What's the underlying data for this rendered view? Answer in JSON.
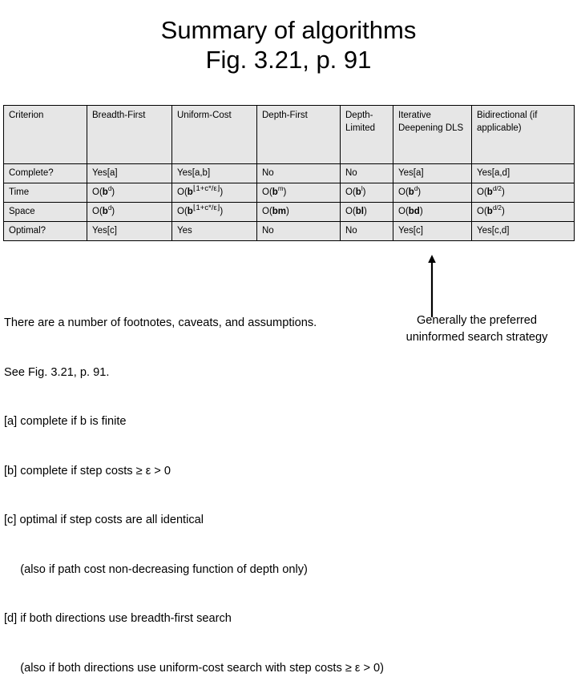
{
  "title": {
    "line1": "Summary of algorithms",
    "line2": "Fig. 3.21, p. 91"
  },
  "table": {
    "headers": [
      "Criterion",
      "Breadth-First",
      "Uniform-Cost",
      "Depth-First",
      "Depth-Limited",
      "Iterative Deepening DLS",
      "Bidirectional (if applicable)"
    ],
    "rows": [
      {
        "criterion": "Complete?",
        "bfs": "Yes[a]",
        "ucs": "Yes[a,b]",
        "dfs": "No",
        "dls": "No",
        "ids": "Yes[a]",
        "bidir": "Yes[a,d]"
      },
      {
        "criterion": "Time",
        "bfs": "O(b^d)",
        "ucs": "O(b^⌊1+C*/ε⌋)",
        "dfs": "O(b^m)",
        "dls": "O(b^l)",
        "ids": "O(b^d)",
        "bidir": "O(b^d/2)"
      },
      {
        "criterion": "Space",
        "bfs": "O(b^d)",
        "ucs": "O(b^⌊1+C*/ε⌋)",
        "dfs": "O(bm)",
        "dls": "O(bl)",
        "ids": "O(bd)",
        "bidir": "O(b^d/2)"
      },
      {
        "criterion": "Optimal?",
        "bfs": "Yes[c]",
        "ucs": "Yes",
        "dfs": "No",
        "dls": "No",
        "ids": "Yes[c]",
        "bidir": "Yes[c,d]"
      }
    ]
  },
  "footnotes": {
    "lines": [
      "There are a number of footnotes, caveats, and assumptions.",
      "See Fig. 3.21, p. 91.",
      "[a] complete if b is finite",
      "[b] complete if step costs ≥ ε > 0",
      "[c] optimal if step costs are all identical",
      "     (also if path cost non-decreasing function of depth only)",
      "[d] if both directions use breadth-first search",
      "     (also if both directions use uniform-cost search with step costs ≥ ε > 0)"
    ]
  },
  "callout": {
    "line1": "Generally the preferred",
    "line2": "uninformed search strategy"
  },
  "colors": {
    "table_fill": "#e6e6e6",
    "table_border": "#000000",
    "page_background": "#ffffff",
    "text": "#000000"
  }
}
